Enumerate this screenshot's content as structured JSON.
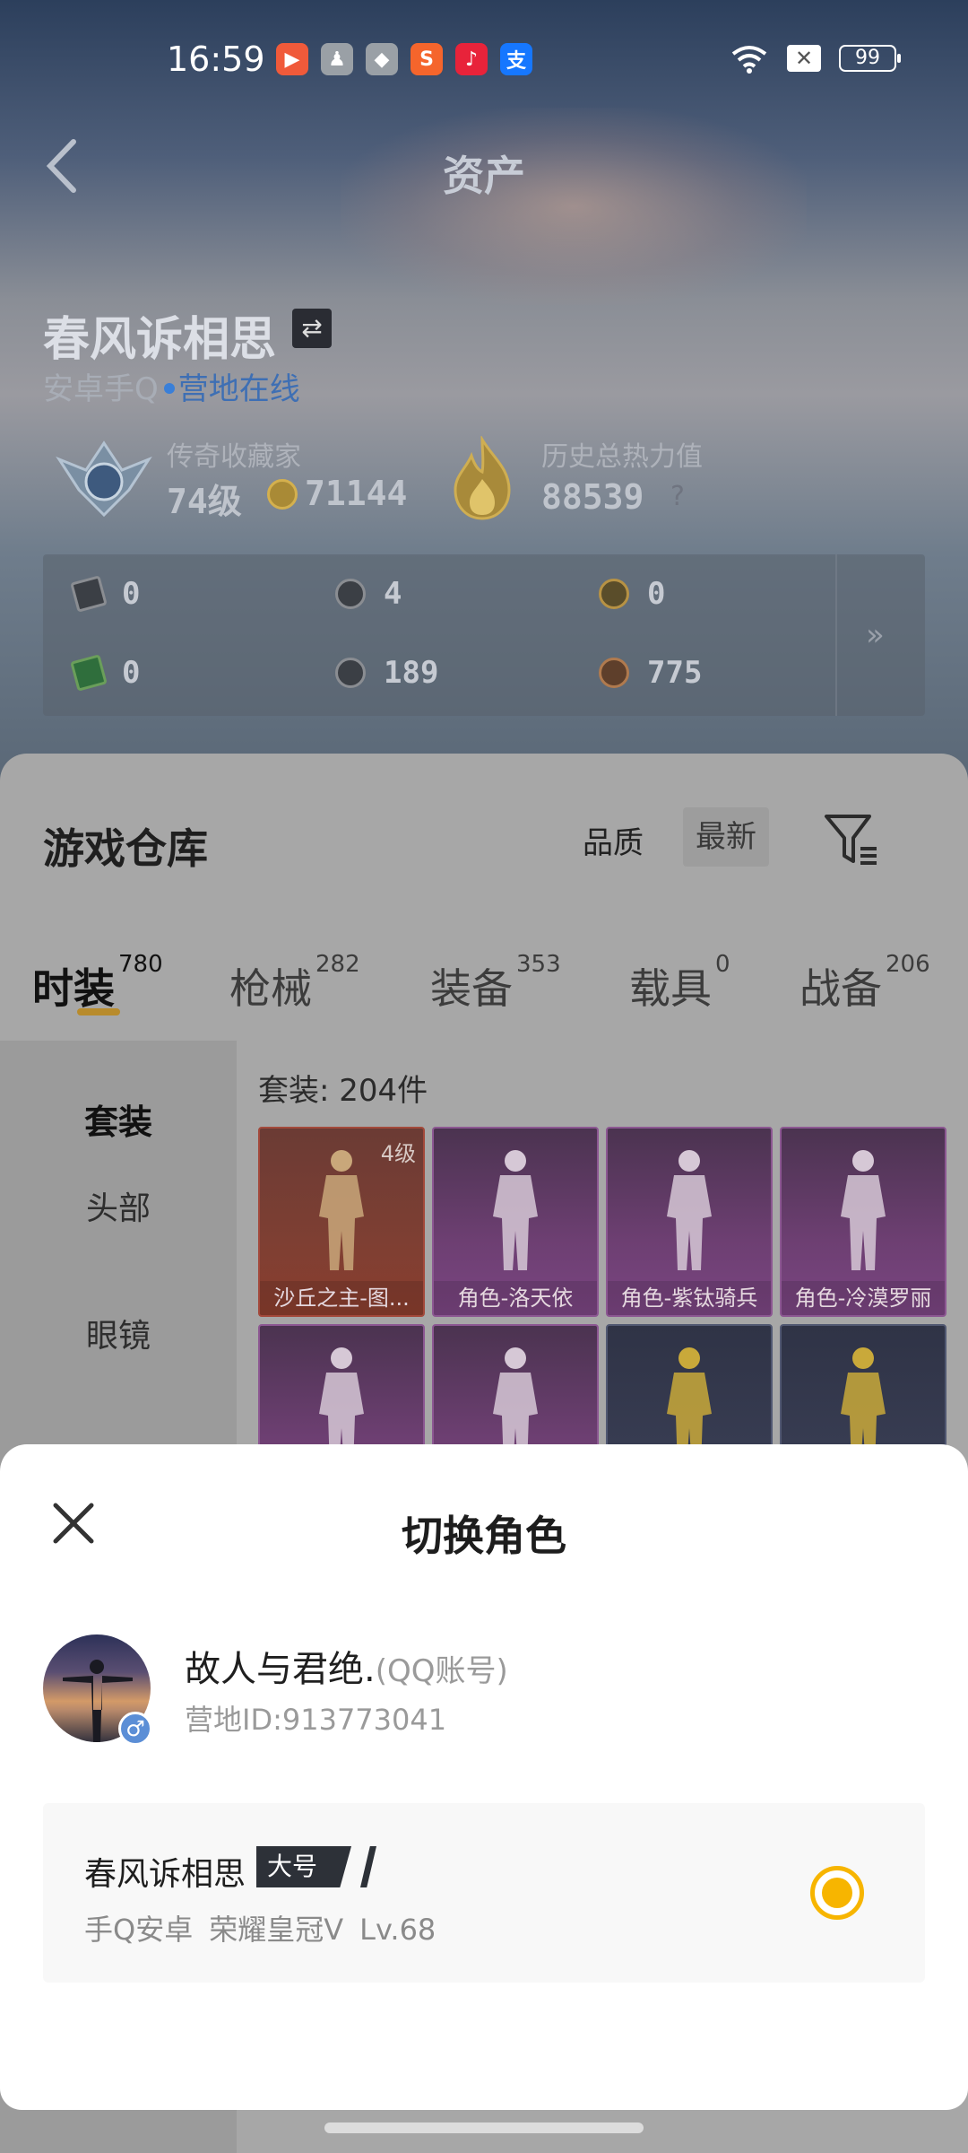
{
  "status_bar": {
    "time": "16:59",
    "apps": [
      {
        "name": "game-app-icon",
        "glyph": "▶",
        "color": "#f05a3a"
      },
      {
        "name": "android-icon",
        "glyph": "♟",
        "color": "#9aa0a6"
      },
      {
        "name": "shield-app-icon",
        "glyph": "◆",
        "color": "#9aa0a6"
      },
      {
        "name": "sogou-icon",
        "glyph": "S",
        "color": "#f5652c"
      },
      {
        "name": "music-icon",
        "glyph": "♪",
        "color": "#e8233a"
      },
      {
        "name": "alipay-icon",
        "glyph": "支",
        "color": "#1677ff"
      }
    ],
    "battery": "99"
  },
  "header": {
    "title": "资产"
  },
  "player": {
    "name": "春风诉相思",
    "swap_glyph": "⇄",
    "platform": "安卓手Q",
    "online": "营地在线"
  },
  "stats": {
    "collector_label": "传奇收藏家",
    "collector_level": "74级",
    "coins": "71144",
    "heat_label": "历史总热力值",
    "heat_value": "88539",
    "help": "?"
  },
  "resources": {
    "row1": [
      "0",
      "4",
      "0"
    ],
    "row2": [
      "0",
      "189",
      "775"
    ],
    "more": "»"
  },
  "warehouse": {
    "title": "游戏仓库",
    "sort_label": "品质",
    "sort_option": "最新",
    "tabs": [
      {
        "label": "时装",
        "count": "780"
      },
      {
        "label": "枪械",
        "count": "282"
      },
      {
        "label": "装备",
        "count": "353"
      },
      {
        "label": "载具",
        "count": "0"
      },
      {
        "label": "战备",
        "count": "206"
      }
    ],
    "side_items": [
      "套装",
      "头部",
      "眼镜"
    ],
    "suit_count": "套装: 204件",
    "items": [
      {
        "label": "沙丘之主-图...",
        "level": "4级",
        "style": "orange"
      },
      {
        "label": "角色-洛天依",
        "level": "",
        "style": "purple"
      },
      {
        "label": "角色-紫钛骑兵",
        "level": "",
        "style": "purple"
      },
      {
        "label": "角色-冷漠罗丽",
        "level": "",
        "style": "purple"
      },
      {
        "label": "",
        "level": "",
        "style": "purple"
      },
      {
        "label": "",
        "level": "",
        "style": "purple"
      },
      {
        "label": "",
        "level": "",
        "style": "blue"
      },
      {
        "label": "",
        "level": "",
        "style": "blue"
      }
    ]
  },
  "sheet": {
    "title": "切换角色",
    "account_name": "故人与君绝.",
    "account_type": "(QQ账号)",
    "camp_id": "营地ID:913773041",
    "gender": "♂",
    "role": {
      "name": "春风诉相思",
      "tag": "大号",
      "platform": "手Q安卓",
      "rank": "荣耀皇冠V",
      "level": "Lv.68"
    }
  },
  "colors": {
    "accent": "#f7b500",
    "online": "#3a7fd8",
    "tab_indicator": "#b88b2c"
  }
}
